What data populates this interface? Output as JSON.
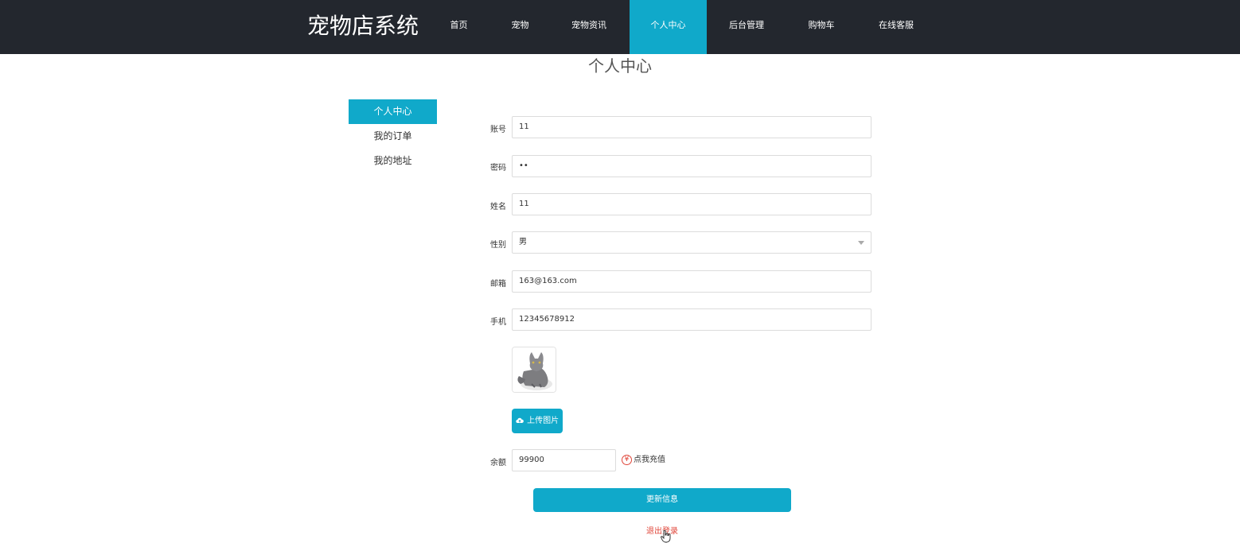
{
  "header": {
    "brand": "宠物店系统",
    "nav": [
      {
        "label": "首页"
      },
      {
        "label": "宠物"
      },
      {
        "label": "宠物资讯"
      },
      {
        "label": "个人中心"
      },
      {
        "label": "后台管理"
      },
      {
        "label": "购物车"
      },
      {
        "label": "在线客服"
      }
    ],
    "active_nav": "个人中心"
  },
  "page": {
    "title": "个人中心"
  },
  "sidebar": {
    "items": [
      {
        "label": "个人中心"
      },
      {
        "label": "我的订单"
      },
      {
        "label": "我的地址"
      }
    ],
    "active": "个人中心"
  },
  "form": {
    "account": {
      "label": "账号",
      "value": "11"
    },
    "password": {
      "label": "密码",
      "value": "••"
    },
    "name": {
      "label": "姓名",
      "value": "11"
    },
    "gender": {
      "label": "性别",
      "value": "男"
    },
    "email": {
      "label": "邮箱",
      "value": "163@163.com"
    },
    "phone": {
      "label": "手机",
      "value": "12345678912"
    },
    "upload_label": "上传图片",
    "balance": {
      "label": "余额",
      "value": "99900"
    },
    "recharge_label": "点我充值",
    "update_label": "更新信息",
    "logout_label": "退出登录"
  },
  "colors": {
    "accent": "#10a9ca",
    "header_bg": "#23272e",
    "danger": "#e0463a"
  }
}
